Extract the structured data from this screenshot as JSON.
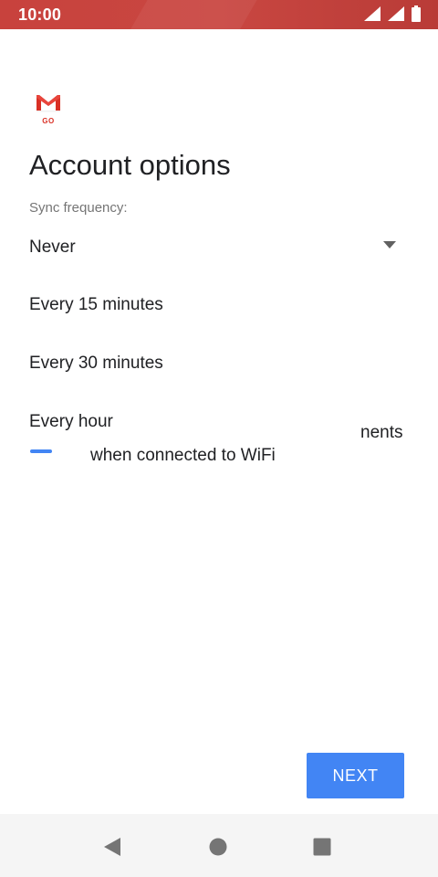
{
  "status_bar": {
    "time": "10:00",
    "icons": [
      "wifi-icon",
      "signal-icon",
      "battery-icon"
    ],
    "color": "#c8423d"
  },
  "app": {
    "logo_icon": "gmail-go-icon",
    "logo_subtext": "GO"
  },
  "page": {
    "title": "Account options",
    "sync_label": "Sync frequency:"
  },
  "sync_dropdown": {
    "selected": "Never",
    "options": [
      "Every 15 minutes",
      "Every 30 minutes",
      "Every hour"
    ]
  },
  "background_content": {
    "partial_text_right": "nents",
    "partial_text_wifi": "when connected to WiFi",
    "accent": "#4285f4"
  },
  "footer": {
    "next_label": "NEXT",
    "next_color": "#4285f4"
  },
  "nav_bar": {
    "icons": [
      "back-icon",
      "home-icon",
      "recents-icon"
    ]
  }
}
